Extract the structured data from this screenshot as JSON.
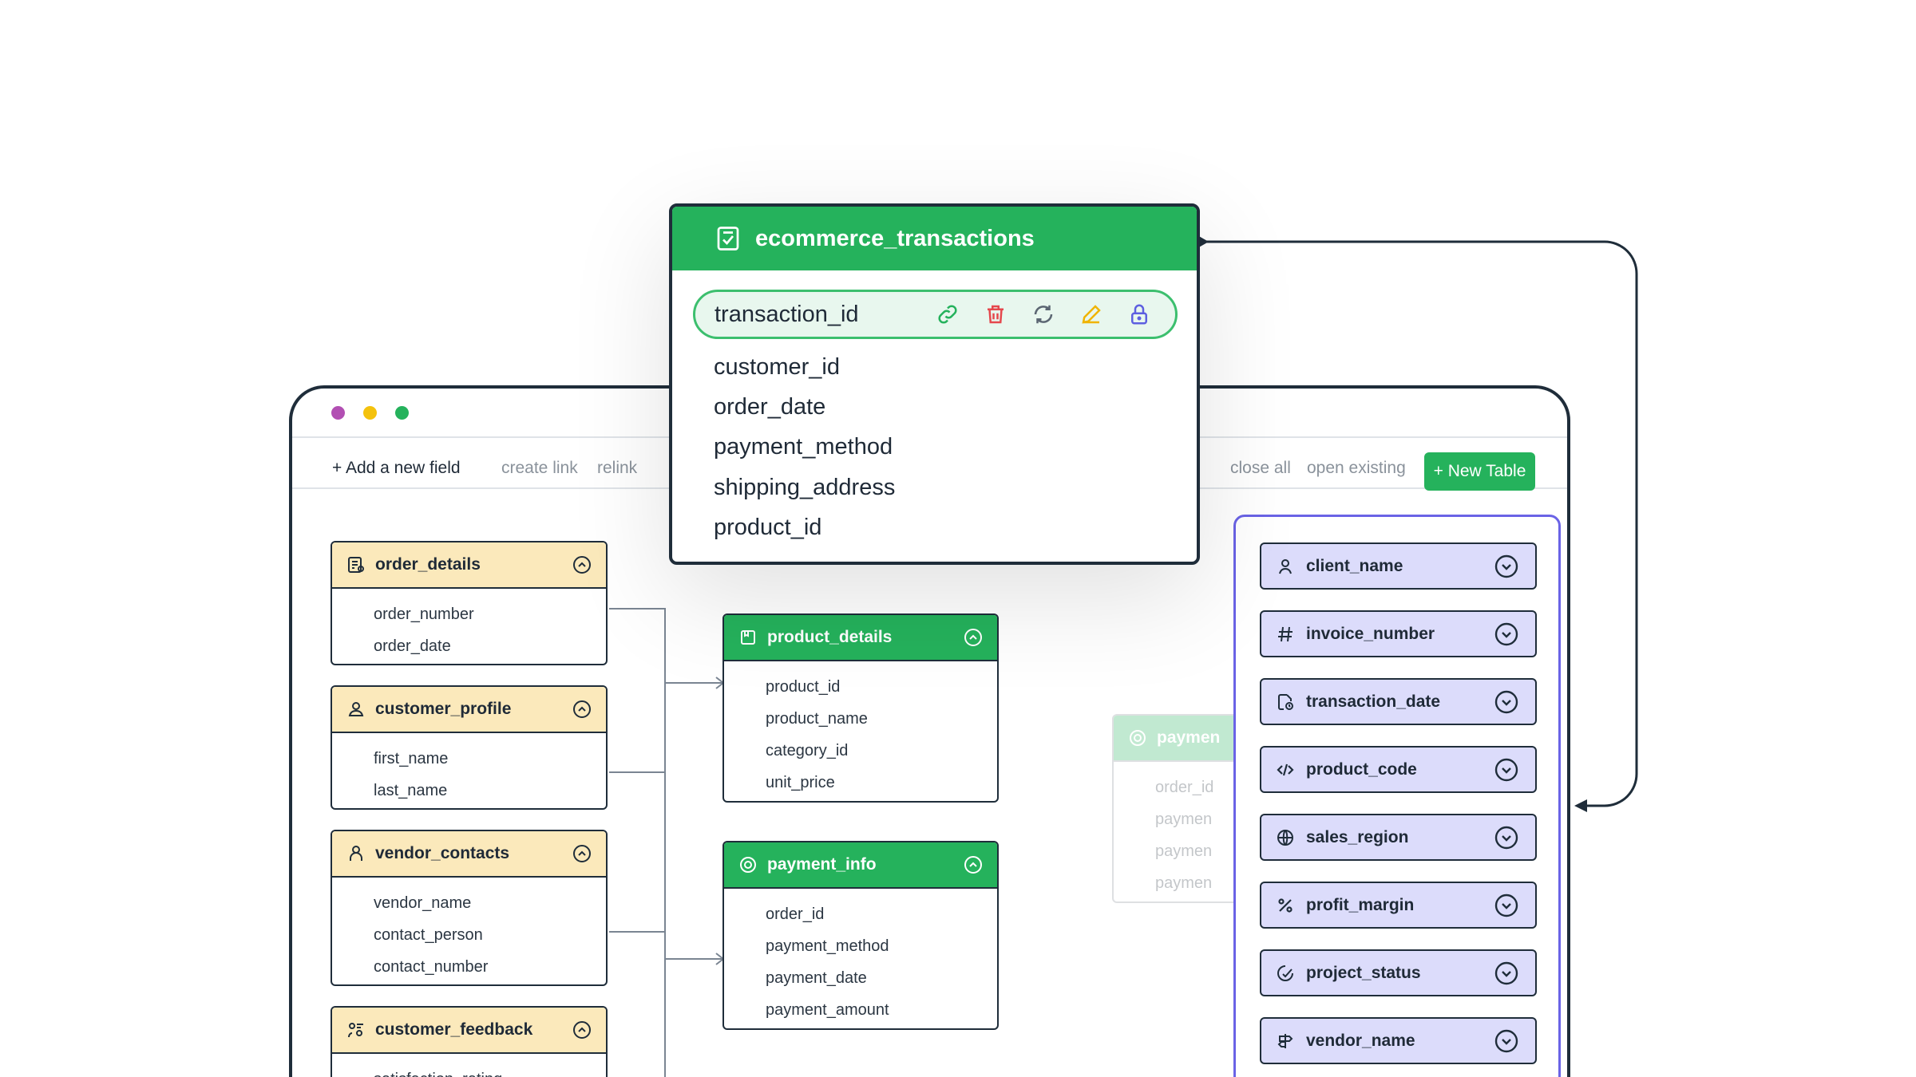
{
  "window": {
    "toolbar": {
      "add_field": "+ Add a new field",
      "create_link": "create link",
      "relink": "relink",
      "close_all": "close all",
      "open_existing": "open existing",
      "new_table": "+ New Table"
    }
  },
  "tables": {
    "order_details": {
      "title": "order_details",
      "rows": [
        "order_number",
        "order_date"
      ],
      "icon": "document-list-icon"
    },
    "customer_profile": {
      "title": "customer_profile",
      "rows": [
        "first_name",
        "last_name"
      ],
      "icon": "user-icon"
    },
    "vendor_contacts": {
      "title": "vendor_contacts",
      "rows": [
        "vendor_name",
        "contact_person",
        "contact_number"
      ],
      "icon": "person-icon"
    },
    "customer_feedback": {
      "title": "customer_feedback",
      "rows": [
        "satisfaction_rating"
      ],
      "icon": "feedback-icon"
    },
    "product_details": {
      "title": "product_details",
      "rows": [
        "product_id",
        "product_name",
        "category_id",
        "unit_price"
      ],
      "icon": "box-icon"
    },
    "payment_info": {
      "title": "payment_info",
      "rows": [
        "order_id",
        "payment_method",
        "payment_date",
        "payment_amount"
      ],
      "icon": "coin-icon"
    },
    "payment_faded": {
      "title": "paymen",
      "rows": [
        "order_id",
        "paymen",
        "paymen",
        "paymen"
      ]
    }
  },
  "right_panel": {
    "fields": [
      {
        "label": "client_name",
        "icon": "user-icon"
      },
      {
        "label": "invoice_number",
        "icon": "hash-icon"
      },
      {
        "label": "transaction_date",
        "icon": "file-clock-icon"
      },
      {
        "label": "product_code",
        "icon": "code-icon"
      },
      {
        "label": "sales_region",
        "icon": "globe-icon"
      },
      {
        "label": "profit_margin",
        "icon": "percent-icon"
      },
      {
        "label": "project_status",
        "icon": "status-icon"
      },
      {
        "label": "vendor_name",
        "icon": "signpost-icon"
      }
    ]
  },
  "popup": {
    "title": "ecommerce_transactions",
    "selected_field": "transaction_id",
    "fields": [
      "customer_id",
      "order_date",
      "payment_method",
      "shipping_address",
      "product_id"
    ]
  },
  "colors": {
    "green": "#25b25c",
    "yellow_header": "#fbe9bb",
    "lavender_field": "#dcdcfb",
    "panel_border": "#6a63e6",
    "dark": "#1f2d3a"
  }
}
